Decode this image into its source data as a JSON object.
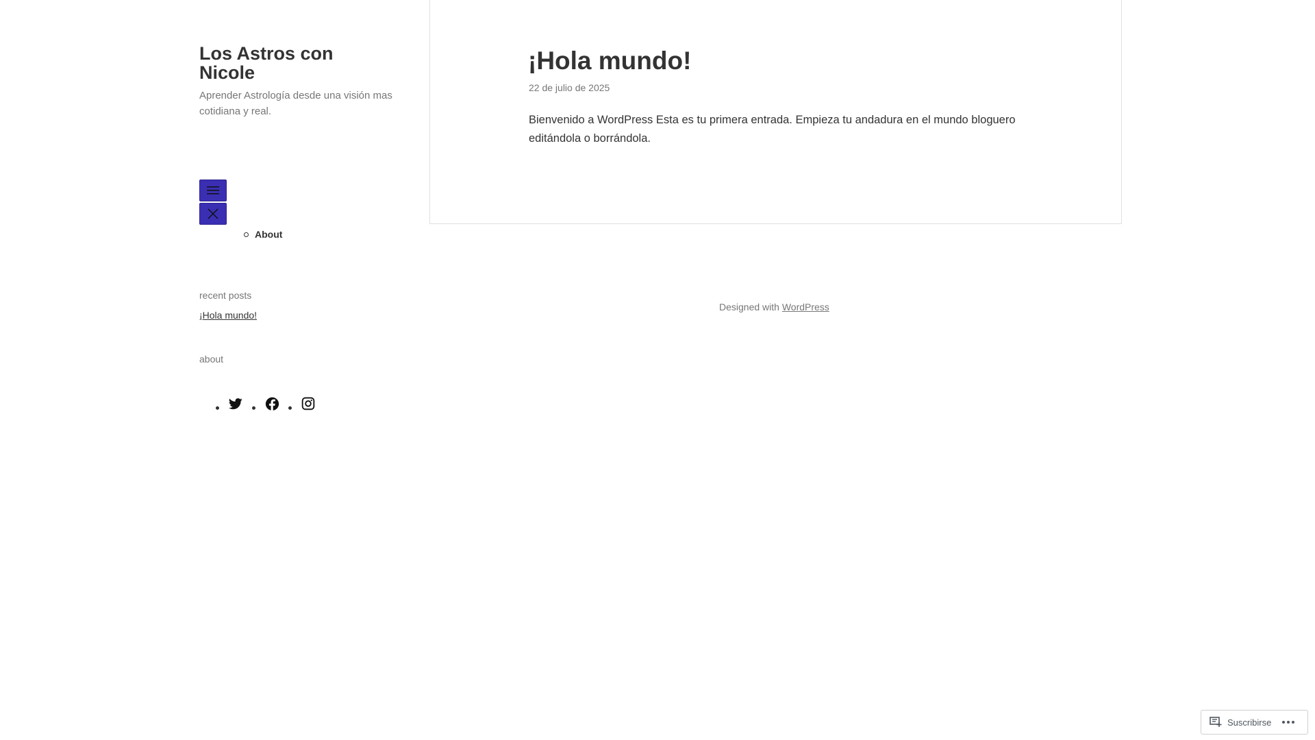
{
  "site": {
    "title": "Los Astros con Nicole",
    "description": "Aprender Astrología desde una visión mas cotidiana y real."
  },
  "navigation": {
    "items": [
      {
        "label": "About"
      }
    ]
  },
  "widgets": {
    "recent_posts_title": "recent posts",
    "recent_posts": [
      {
        "label": "¡Hola mundo!"
      }
    ],
    "about_title": "about",
    "social_icons": [
      "twitter-icon",
      "facebook-icon",
      "instagram-icon"
    ]
  },
  "post": {
    "title": "¡Hola mundo!",
    "date": "22 de julio de 2025",
    "content": "Bienvenido a WordPress Esta es tu primera entrada. Empieza tu andadura en el mundo bloguero editándola o borrándola."
  },
  "footer": {
    "prefix": "Designed with",
    "link_label": "WordPress"
  },
  "subscribe": {
    "label": "Suscribirse"
  },
  "colors": {
    "accent": "#3a2fb3",
    "text": "#333333",
    "muted": "#767676",
    "border": "#e0e0e0"
  }
}
